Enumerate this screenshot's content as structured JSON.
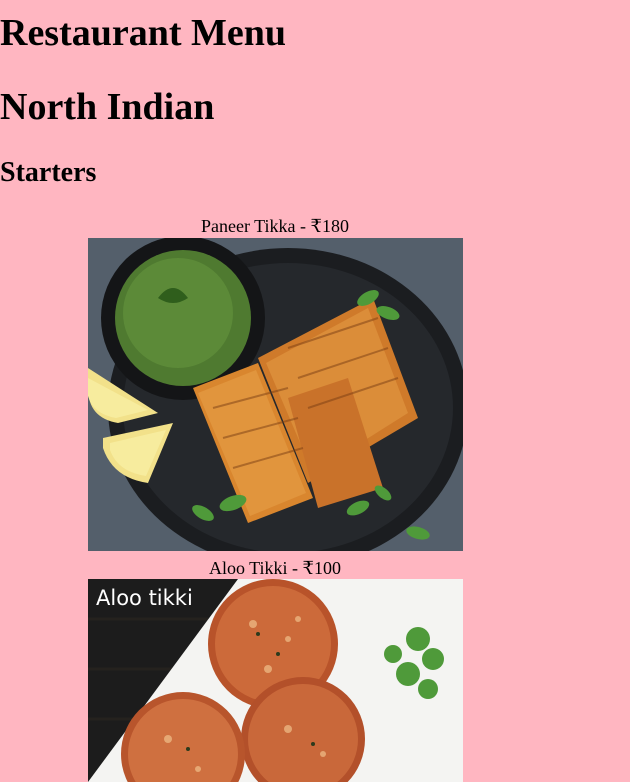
{
  "header": {
    "title": "Restaurant Menu",
    "cuisine": "North Indian",
    "section": "Starters"
  },
  "items": [
    {
      "label": "Paneer Tikka - ₹180"
    },
    {
      "label": "Aloo Tikki - ₹100",
      "photo_caption": "Aloo tikki"
    }
  ]
}
